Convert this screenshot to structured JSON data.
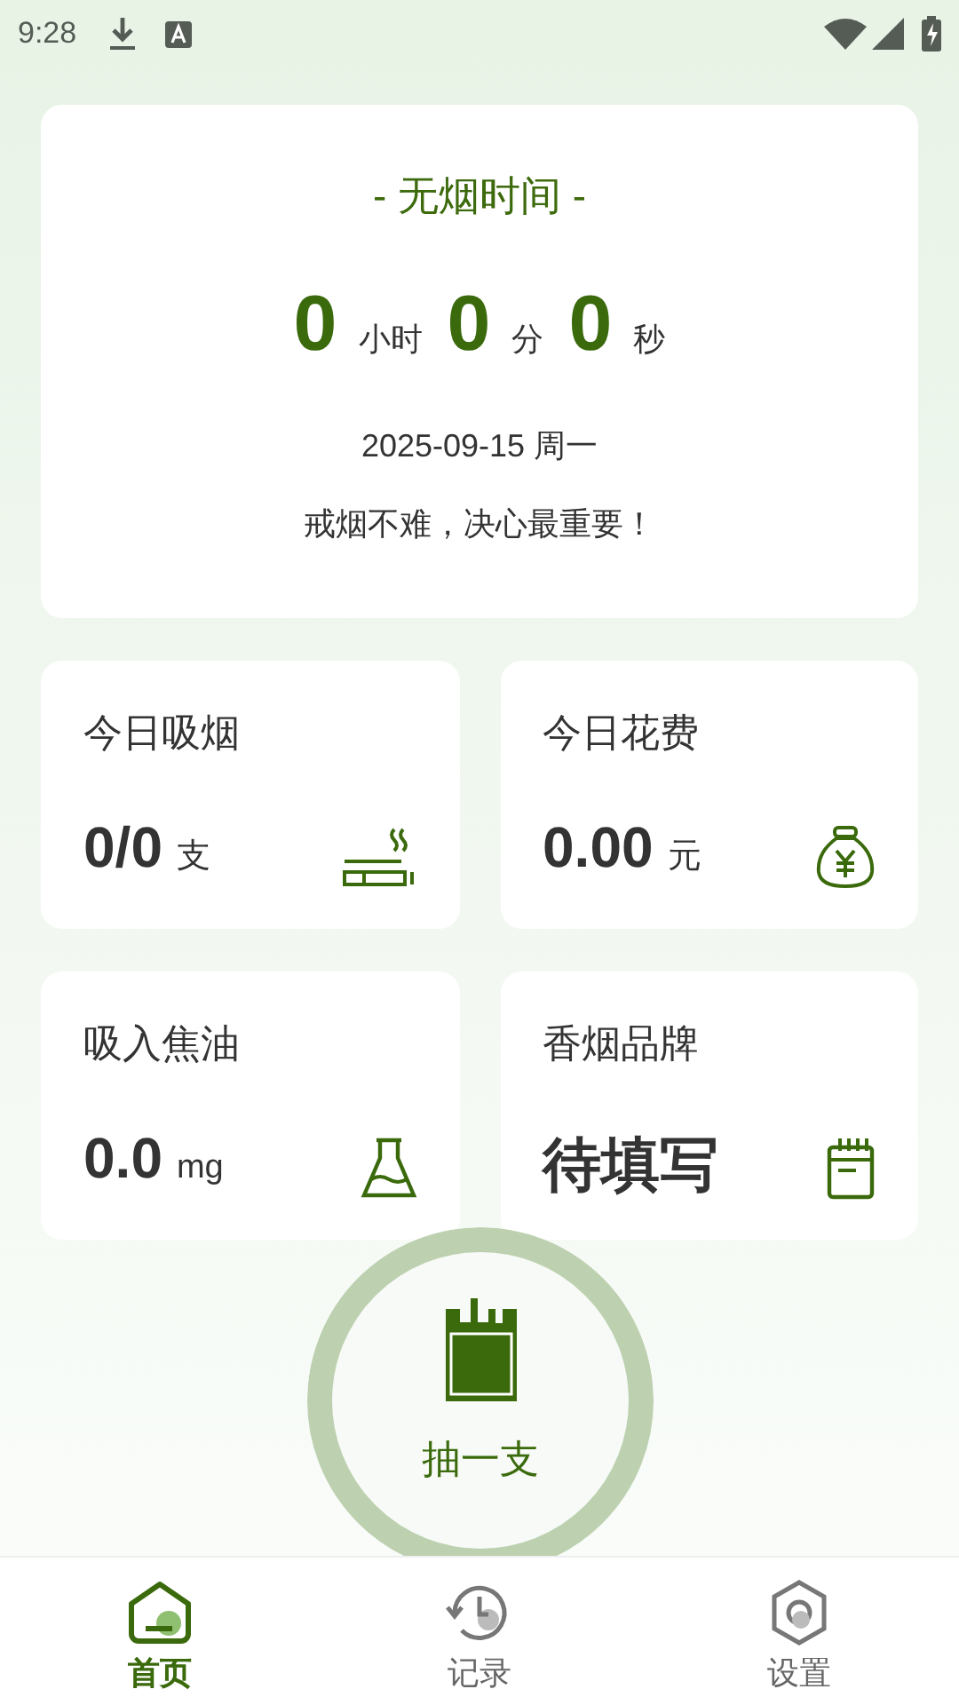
{
  "status_bar": {
    "time": "9:28"
  },
  "timer": {
    "title": "- 无烟时间 -",
    "parts": [
      {
        "value": "0",
        "unit": "小时"
      },
      {
        "value": "0",
        "unit": "分"
      },
      {
        "value": "0",
        "unit": "秒"
      }
    ],
    "date": "2025-09-15 周一",
    "motto": "戒烟不难，决心最重要！"
  },
  "stats": [
    {
      "label": "今日吸烟",
      "value": "0/0",
      "unit": "支"
    },
    {
      "label": "今日花费",
      "value": "0.00",
      "unit": "元"
    },
    {
      "label": "吸入焦油",
      "value": "0.0",
      "unit": "mg"
    },
    {
      "label": "香烟品牌",
      "value": "待填写"
    }
  ],
  "smoke_button": {
    "label": "抽一支"
  },
  "tabs": [
    {
      "label": "首页",
      "selected": true
    },
    {
      "label": "记录",
      "selected": false
    },
    {
      "label": "设置",
      "selected": false
    }
  ]
}
